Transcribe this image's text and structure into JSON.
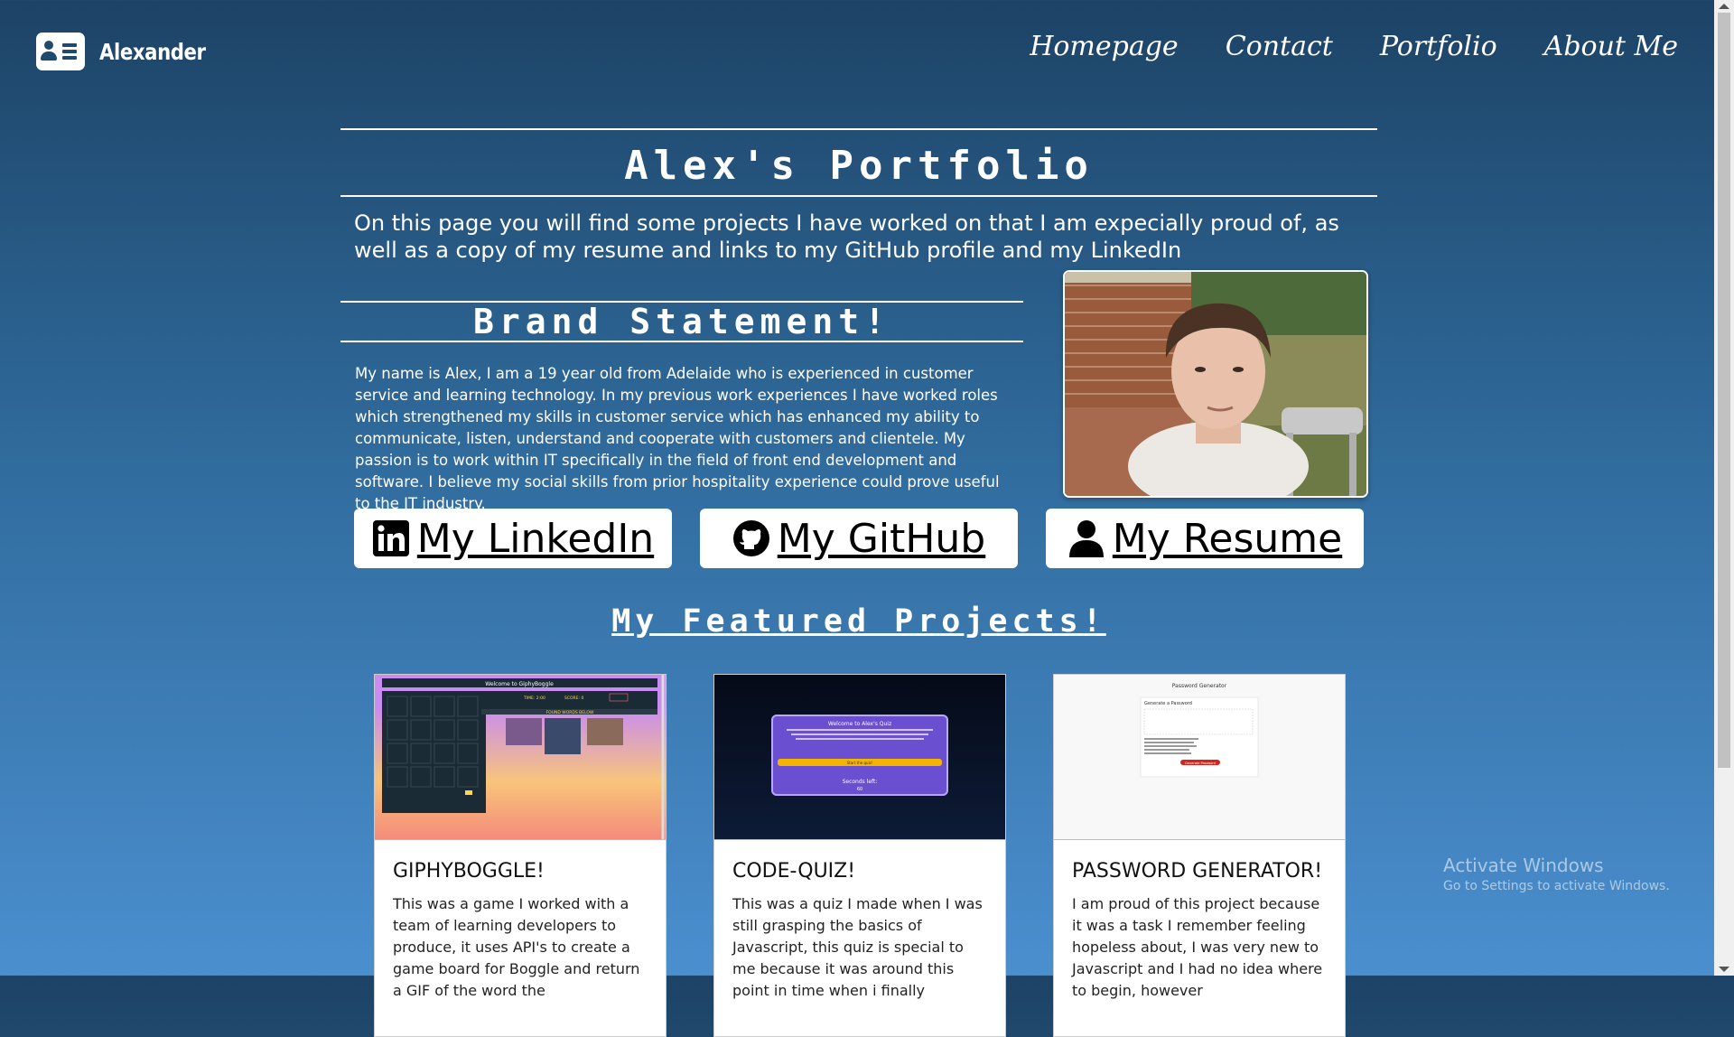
{
  "navbar": {
    "brand_name": "Alexander",
    "links": [
      "Homepage",
      "Contact",
      "Portfolio",
      "About Me"
    ]
  },
  "header": {
    "title": "Alex's Portfolio",
    "intro": "On this page you will find some projects I have worked on that I am expecially proud of, as well as a copy of my resume and links to my GitHub profile and my LinkedIn"
  },
  "brand_section": {
    "title": "Brand Statement!",
    "text": "My name is Alex, I am a 19 year old from Adelaide who is experienced in customer service and learning technology. In my previous work experiences I have worked roles which strengthened my skills in customer service which has enhanced my ability to communicate, listen, understand and cooperate with customers and clientele. My passion is to work within IT specifically in the field of front end development and software. I believe my social skills from prior hospitality experience could prove useful to the IT industry."
  },
  "links": {
    "linkedin": "My LinkedIn",
    "github": "My GitHub",
    "resume": "My Resume"
  },
  "featured": {
    "title": "My Featured Projects!",
    "cards": [
      {
        "title": "GIPHYBOGGLE!",
        "text": "This was a game I worked with a team of learning developers to produce, it uses API's to create a game board for Boggle and return a GIF of the word the"
      },
      {
        "title": "CODE-QUIZ!",
        "text": "This was a quiz I made when I was still grasping the basics of Javascript, this quiz is special to me because it was around this point in time when i finally"
      },
      {
        "title": "PASSWORD GENERATOR!",
        "text": "I am proud of this project because it was a task I remember feeling hopeless about, I was very new to Javascript and I had no idea where to begin, however"
      }
    ]
  },
  "thumbnails": {
    "boggle_welcome": "Welcome to GiphyBoggle",
    "boggle_time": "TIME: 2:00",
    "boggle_score": "SCORE: 0",
    "boggle_found": "FOUND WORDS BELOW",
    "quiz_title": "Welcome to Alex's Quiz",
    "quiz_button": "Start the quiz!",
    "quiz_seconds": "Seconds left:",
    "quiz_count": "60",
    "pw_title": "Password Generator",
    "pw_heading": "Generate a Password",
    "pw_button": "Generate Password"
  },
  "watermark": {
    "line1": "Activate Windows",
    "line2": "Go to Settings to activate Windows."
  },
  "colors": {
    "bg_top": "#1d4366",
    "bg_bottom": "#4b8fcf"
  }
}
